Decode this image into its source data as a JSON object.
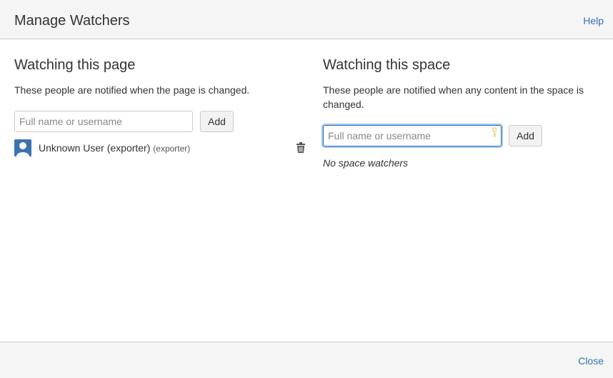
{
  "dialog": {
    "title": "Manage Watchers",
    "help_label": "Help",
    "close_label": "Close"
  },
  "page_watchers": {
    "heading": "Watching this page",
    "description": "These people are notified when the page is changed.",
    "input_placeholder": "Full name or username",
    "input_value": "",
    "add_label": "Add",
    "watchers": [
      {
        "display_name": "Unknown User (exporter)",
        "username": "(exporter)",
        "avatar": "default-user-icon",
        "remove_icon": "trash-icon"
      }
    ]
  },
  "space_watchers": {
    "heading": "Watching this space",
    "description": "These people are notified when any content in the space is changed.",
    "input_placeholder": "Full name or username",
    "input_value": "",
    "add_label": "Add",
    "empty_text": "No space watchers",
    "input_icon": "key-icon"
  },
  "colors": {
    "link": "#3572b0",
    "focus_ring": "#9ec7ef",
    "avatar_bg": "#3b73af"
  }
}
